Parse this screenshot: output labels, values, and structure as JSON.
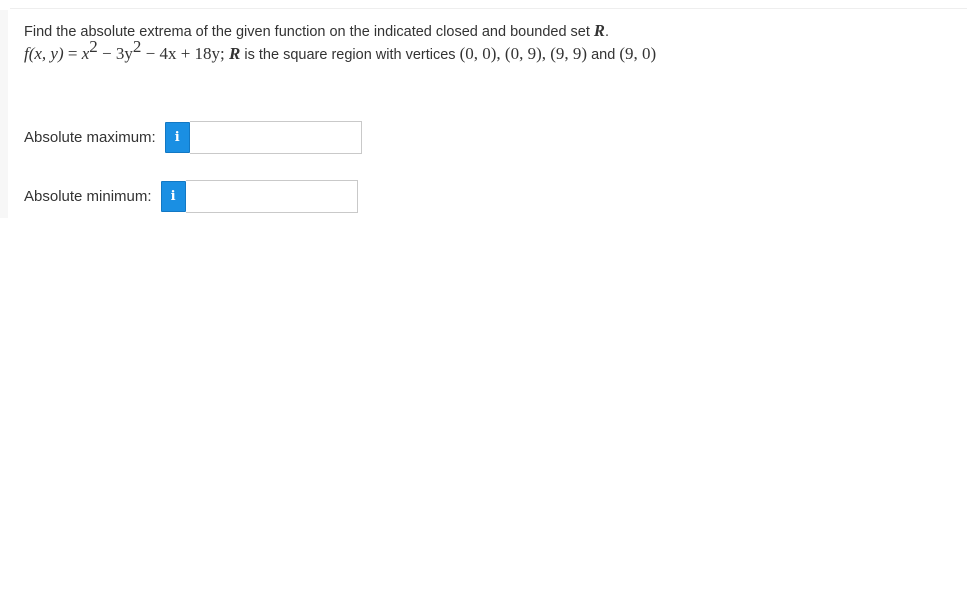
{
  "question": {
    "instruction_prefix": "Find the absolute extrema of the given function on the indicated closed and bounded set ",
    "instruction_set_symbol": "R",
    "instruction_suffix": ".",
    "function_lhs": "f(x, y)",
    "function_eq": " = ",
    "function_rhs_1": "x",
    "function_exp_1": "2",
    "function_rhs_2": " − 3y",
    "function_exp_2": "2",
    "function_rhs_3": " − 4x + 18y; ",
    "region_symbol": "R",
    "region_text": " is the square region with vertices ",
    "vertices": "(0, 0), (0, 9), (9, 9)",
    "and_text": " and ",
    "last_vertex": "(9, 0)"
  },
  "answers": {
    "max_label": "Absolute maximum:",
    "max_value": "",
    "min_label": "Absolute minimum:",
    "min_value": "",
    "info_glyph": "i",
    "info_icon_color": "#1a8fe3"
  }
}
